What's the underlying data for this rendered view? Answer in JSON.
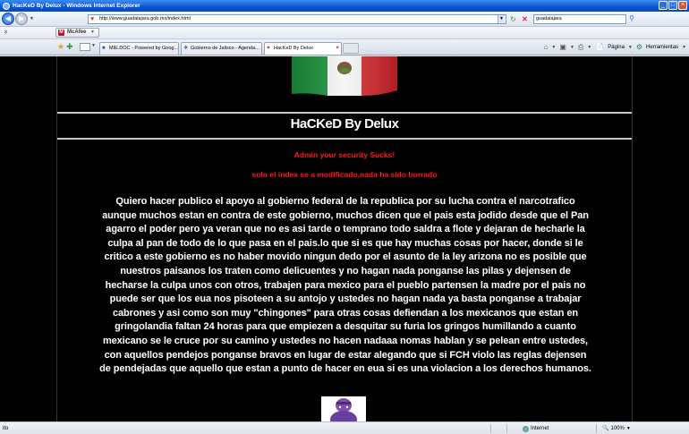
{
  "window": {
    "title": "HacKeD By Delux - Windows Internet Explorer",
    "minimize": "_",
    "maximize": "□",
    "close": "×"
  },
  "addressbar": {
    "url": "http://www.guadalajara.gob.mx/index.html",
    "search_value": "guadalajara"
  },
  "toolbar": {
    "mcafee_label": "McAfee"
  },
  "tabs": [
    {
      "label": "MIE.DOC - Powered by Goog...",
      "active": false
    },
    {
      "label": "Gobierno de Jalisco - Agenda...",
      "active": false
    },
    {
      "label": "HacKeD By Delux",
      "active": true
    }
  ],
  "commandbar": {
    "page_label": "Página",
    "tools_label": "Herramientas"
  },
  "page": {
    "headline": "HaCKeD By Delux",
    "line_red_1": "Admin your security Sucks!",
    "line_red_2": "solo el index se a modificado,nada ha sido borrado",
    "message_lines": [
      "Quiero hacer publico el apoyo al gobierno federal de la republica por su lucha contra el narcotrafico",
      "aunque muchos estan en contra de este gobierno, muchos dicen que el pais esta jodido desde que el Pan",
      "agarro el poder pero ya veran que no es asi tarde o temprano todo saldra a flote y dejaran de hecharle la",
      "culpa al pan de todo de lo que pasa en el pais.lo que si es que hay muchas cosas por hacer, donde si le",
      "critico a este gobierno es no haber movido ningun dedo por el asunto de la ley arizona no es posible que",
      "nuestros paisanos los traten como delicuentes y no hagan nada ponganse las pilas y dejensen de",
      "hecharse la culpa unos con otros, trabajen para mexico para el pueblo partensen la madre por el pais no",
      "puede ser que los eua nos pisoteen a su antojo y ustedes no hagan nada ya basta ponganse a trabajar",
      "cabrones y asi como son muy \"chingones\" para otras cosas defiendan a los mexicanos que estan en",
      "gringolandia faltan 24 horas para que empiezen a desquitar su furia los gringos humillando a cuanto",
      "mexicano se le cruce por su camino y ustedes no hacen nadaaa nomas hablan y se pelean entre ustedes,",
      "con aquellos pendejos ponganse bravos en lugar de estar alegando que si FCH violo las reglas dejensen",
      "de pendejadas que aquello que estan a punto de hacer en eua si es una violacion a los derechos humanos."
    ]
  },
  "statusbar": {
    "status": "ito",
    "zone": "Internet",
    "zoom": "100%"
  },
  "colors": {
    "page_bg": "#000000",
    "headline": "#ffffff",
    "alert_red": "#ff1a1a",
    "titlebar_blue": "#0a56d6"
  }
}
